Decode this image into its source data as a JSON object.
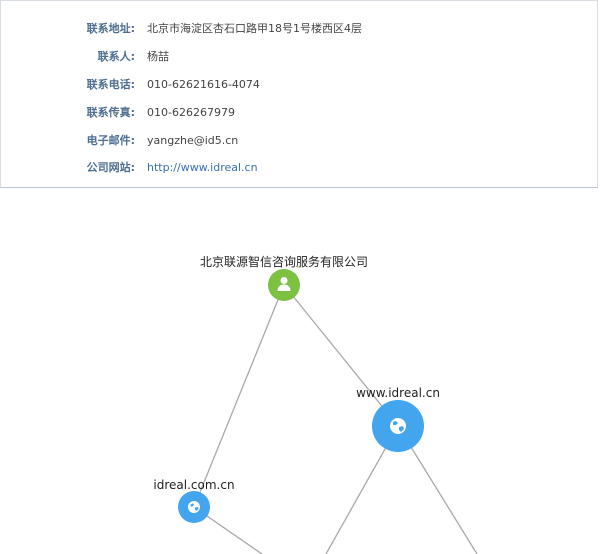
{
  "contact": {
    "rows": [
      {
        "label": "联系地址:",
        "value": "北京市海淀区杏石口路甲18号1号楼西区4层"
      },
      {
        "label": "联系人:",
        "value": "杨喆"
      },
      {
        "label": "联系电话:",
        "value": "010-62621616-4074"
      },
      {
        "label": "联系传真:",
        "value": "010-626267979"
      },
      {
        "label": "电子邮件:",
        "value": "yangzhe@id5.cn"
      },
      {
        "label": "公司网站:",
        "value": "http://www.idreal.cn"
      }
    ]
  },
  "graph": {
    "nodes": [
      {
        "id": "company",
        "label": "北京联源智信咨询服务有限公司",
        "icon": "person-icon",
        "color": "#7cc142"
      },
      {
        "id": "domain-www",
        "label": "www.idreal.cn",
        "icon": "globe-icon",
        "color": "#42a5ee"
      },
      {
        "id": "domain-com",
        "label": "idreal.com.cn",
        "icon": "globe-icon",
        "color": "#42a5ee"
      }
    ],
    "edge_color": "#a9a9a9"
  }
}
